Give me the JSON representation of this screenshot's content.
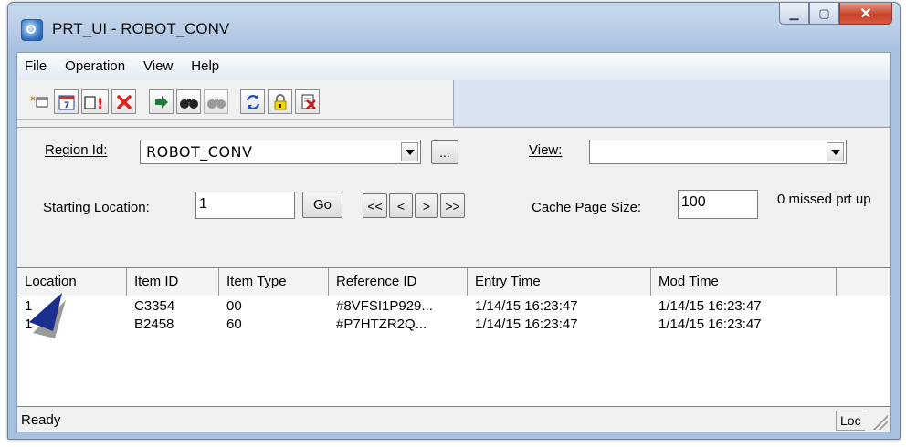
{
  "window": {
    "title": "PRT_UI - ROBOT_CONV"
  },
  "menu": [
    "File",
    "Operation",
    "View",
    "Help"
  ],
  "toolbar_icons": [
    "new-icon",
    "calendar-icon",
    "alert-icon",
    "delete-icon",
    "go-arrow-icon",
    "find-icon",
    "find-disabled-icon",
    "refresh-icon",
    "lock-icon",
    "clear-icon"
  ],
  "filters": {
    "region_label": "Region Id:",
    "region_value": "ROBOT_CONV",
    "browse_label": "...",
    "view_label": "View:",
    "view_value": "",
    "start_label": "Starting Location:",
    "start_value": "1",
    "go_label": "Go",
    "nav_first": "<<",
    "nav_prev": "<",
    "nav_next": ">",
    "nav_last": ">>",
    "cache_label": "Cache Page Size:",
    "cache_value": "100",
    "missed_text": "0 missed prt up"
  },
  "table": {
    "columns": [
      "Location",
      "Item ID",
      "Item Type",
      "Reference ID",
      "Entry Time",
      "Mod Time"
    ],
    "rows": [
      [
        "1",
        "C3354",
        "00",
        "#8VFSI1P929...",
        "1/14/15 16:23:47",
        "1/14/15 16:23:47"
      ],
      [
        "1",
        "B2458",
        "60",
        "#P7HTZR2Q...",
        "1/14/15 16:23:47",
        "1/14/15 16:23:47"
      ]
    ]
  },
  "status": {
    "text": "Ready",
    "pane": "Loc"
  }
}
